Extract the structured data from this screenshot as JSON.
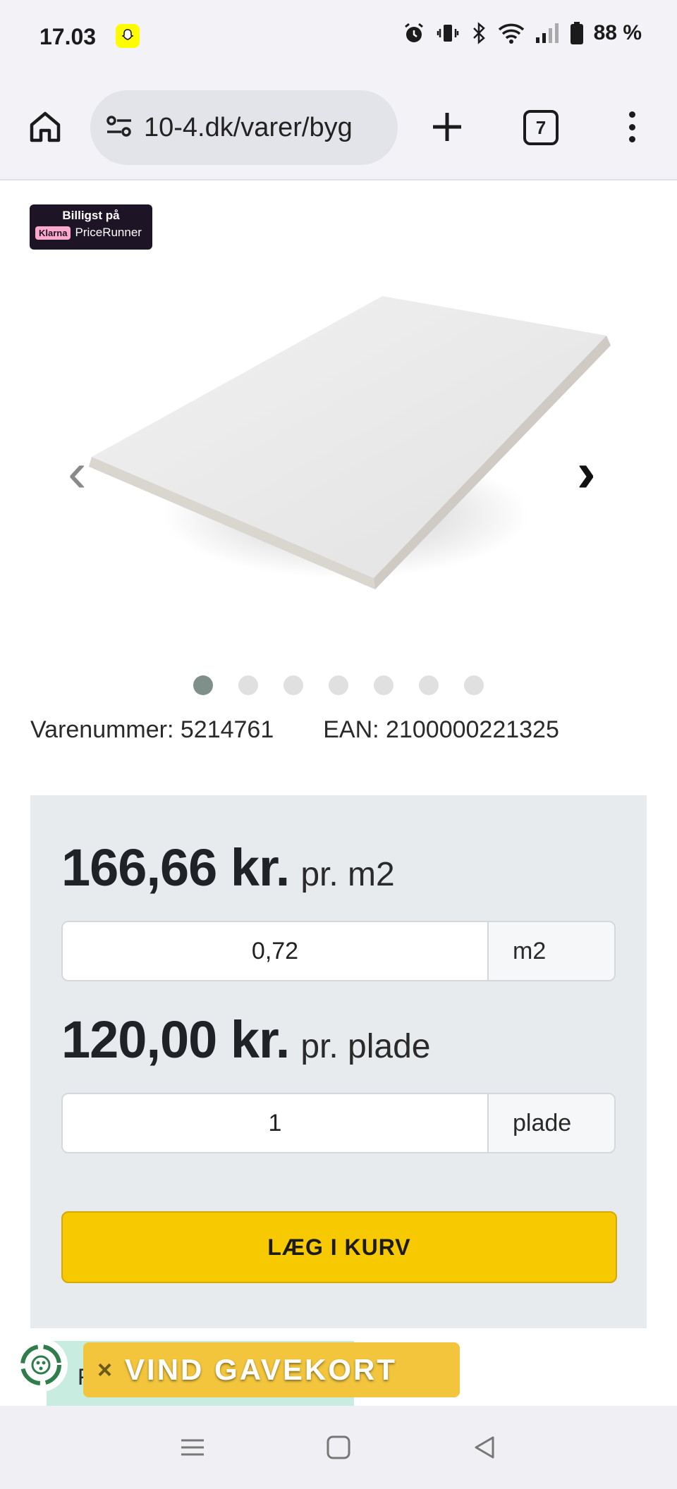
{
  "status_bar": {
    "time": "17.03",
    "battery": "88 %",
    "icons": [
      "snapchat-icon",
      "alarm-icon",
      "vibrate-icon",
      "bluetooth-icon",
      "wifi-icon",
      "signal-icon",
      "battery-icon"
    ]
  },
  "browser": {
    "url": "10-4.dk/varer/byg",
    "tab_count": "7",
    "icons": [
      "home-icon",
      "site-settings-icon",
      "plus-icon",
      "tabs-icon",
      "more-menu-icon"
    ]
  },
  "badge": {
    "top": "Billigst på",
    "klarna": "Klarna",
    "brand": "PriceRunner"
  },
  "gallery": {
    "prev": "‹",
    "next": "›",
    "dot_count": 7,
    "active_index": 0
  },
  "product_meta": {
    "item_number": "Varenummer: 5214761",
    "ean": "EAN: 2100000221325"
  },
  "pricing": {
    "price_per_m2": "166,66 kr.",
    "per_m2_label": "pr. m2",
    "area_value": "0,72",
    "area_unit": "m2",
    "price_per_plate": "120,00 kr.",
    "per_plate_label": "pr. plade",
    "plate_value": "1",
    "plate_unit": "plade",
    "add_to_cart": "LÆG I KURV"
  },
  "below_fold": {
    "text": "Fragtpriser og leveringstid"
  },
  "gift_banner": {
    "close": "×",
    "text": "VIND GAVEKORT"
  },
  "colors": {
    "accent_yellow": "#f6c900",
    "price_box_bg": "#e8ebee",
    "banner_yellow": "#f2c53d"
  }
}
